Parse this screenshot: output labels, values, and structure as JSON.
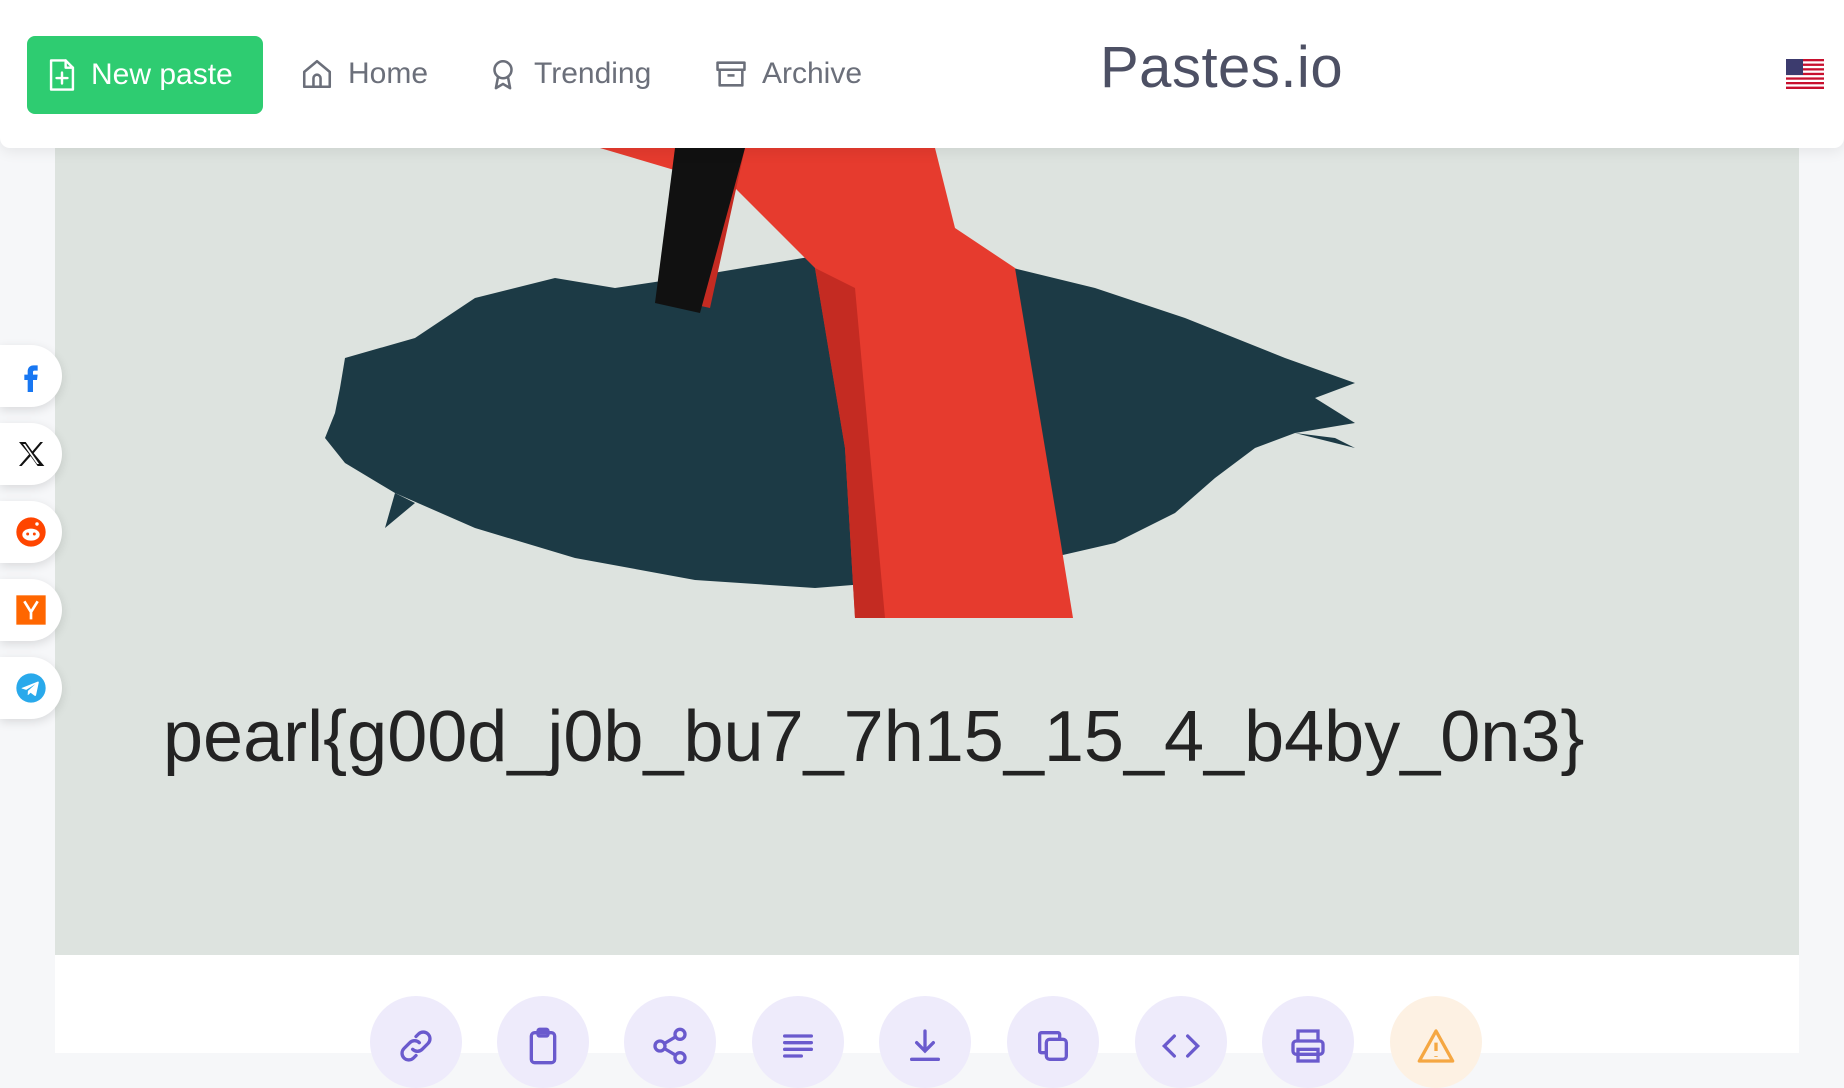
{
  "header": {
    "new_paste_label": "New paste",
    "nav": [
      {
        "label": "Home",
        "icon": "home-icon"
      },
      {
        "label": "Trending",
        "icon": "award-icon"
      },
      {
        "label": "Archive",
        "icon": "archive-icon"
      }
    ],
    "site_title": "Pastes.io",
    "language_flag": "us-flag-icon"
  },
  "content": {
    "image_text": "pearl{g00d_j0b_bu7_7h15_15_4_b4by_0n3}"
  },
  "share": [
    "facebook-icon",
    "x-icon",
    "reddit-icon",
    "hackernews-icon",
    "telegram-icon"
  ],
  "actions": [
    "link-icon",
    "clipboard-icon",
    "share-icon",
    "text-align-icon",
    "download-icon",
    "copy-icon",
    "code-icon",
    "print-icon",
    "warning-icon"
  ],
  "colors": {
    "accent_green": "#2ecc71",
    "action_purple": "#6a5acd",
    "warning_orange": "#f5a742",
    "hole_dark": "#1c3a45",
    "hand_red": "#e63b2e"
  }
}
